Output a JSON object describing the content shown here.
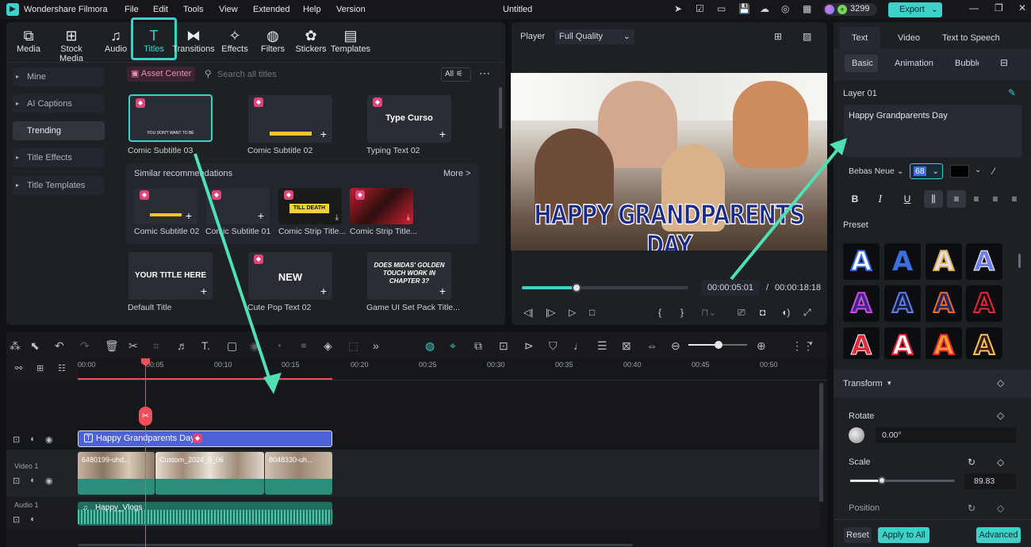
{
  "app": {
    "name": "Wondershare Filmora",
    "project": "Untitled",
    "credits": "3299",
    "export_label": "Export"
  },
  "menu": [
    "File",
    "Edit",
    "Tools",
    "View",
    "Extended",
    "Help",
    "Version"
  ],
  "toolbar": [
    "Media",
    "Stock Media",
    "Audio",
    "Titles",
    "Transitions",
    "Effects",
    "Filters",
    "Stickers",
    "Templates"
  ],
  "sidebar": [
    "Mine",
    "AI Captions",
    "Trending",
    "Title Effects",
    "Title Templates"
  ],
  "library": {
    "asset_center": "Asset Center",
    "search_placeholder": "Search all titles",
    "filter": "All",
    "items_row1": [
      "Comic Subtitle 03",
      "Comic Subtitle 02",
      "Typing Text 02"
    ],
    "similar_header": "Similar recommendations",
    "more": "More >",
    "similar": [
      "Comic Subtitle 02",
      "Comic Subtitle 01",
      "Comic Strip Title...",
      "Comic Strip Title..."
    ],
    "items_row3": [
      "Default Title",
      "Cute Pop Text 02",
      "Game UI Set Pack Title..."
    ],
    "thumb_texts": {
      "t1": "YOU DON'T WANT TO BE",
      "t3": "Type Curso",
      "t4": "YOUR TITLE HERE",
      "t5": "NEW",
      "t6": "DOES MIDAS' GOLDEN TOUCH WORK IN CHAPTER 3?",
      "s3": "TILL DEATH"
    }
  },
  "player": {
    "label": "Player",
    "quality": "Full Quality",
    "overlay_text": "HAPPY GRANDPARENTS DAY",
    "current": "00:00:05:01",
    "separator": "/",
    "total": "00:00:18:18",
    "progress": 0.33
  },
  "props": {
    "tabs": [
      "Text",
      "Video",
      "Text to Speech"
    ],
    "subtabs": [
      "Basic",
      "Animation",
      "Bubble"
    ],
    "layer": "Layer 01",
    "text_value": "Happy Grandparents Day",
    "font": "Bebas Neue",
    "size": "68",
    "preset_label": "Preset",
    "transform": "Transform",
    "rotate_label": "Rotate",
    "rotate_value": "0.00°",
    "scale_label": "Scale",
    "scale_value": "89.83",
    "scale_level": 0.3,
    "position_label": "Position",
    "reset": "Reset",
    "apply_all": "Apply to All",
    "advanced": "Advanced"
  },
  "timeline": {
    "ruler": [
      "00:00",
      "00:05",
      "00:10",
      "00:15",
      "00:20",
      "00:25",
      "00:30",
      "00:35",
      "00:40",
      "00:45",
      "00:50"
    ],
    "title_clip": "Happy Grandparents Day",
    "video_track": "Video 1",
    "audio_track": "Audio 1",
    "clips": [
      "6480199-uhd...",
      "Custom_2024_0_06",
      "8048330-uh..."
    ],
    "audio_clip": "Happy_Vlogs"
  },
  "colors": {
    "accent": "#3fd0c9",
    "title_clip": "#4e62d8",
    "video_clip": "#2c8d7a",
    "playhead": "#ef4f5a"
  }
}
